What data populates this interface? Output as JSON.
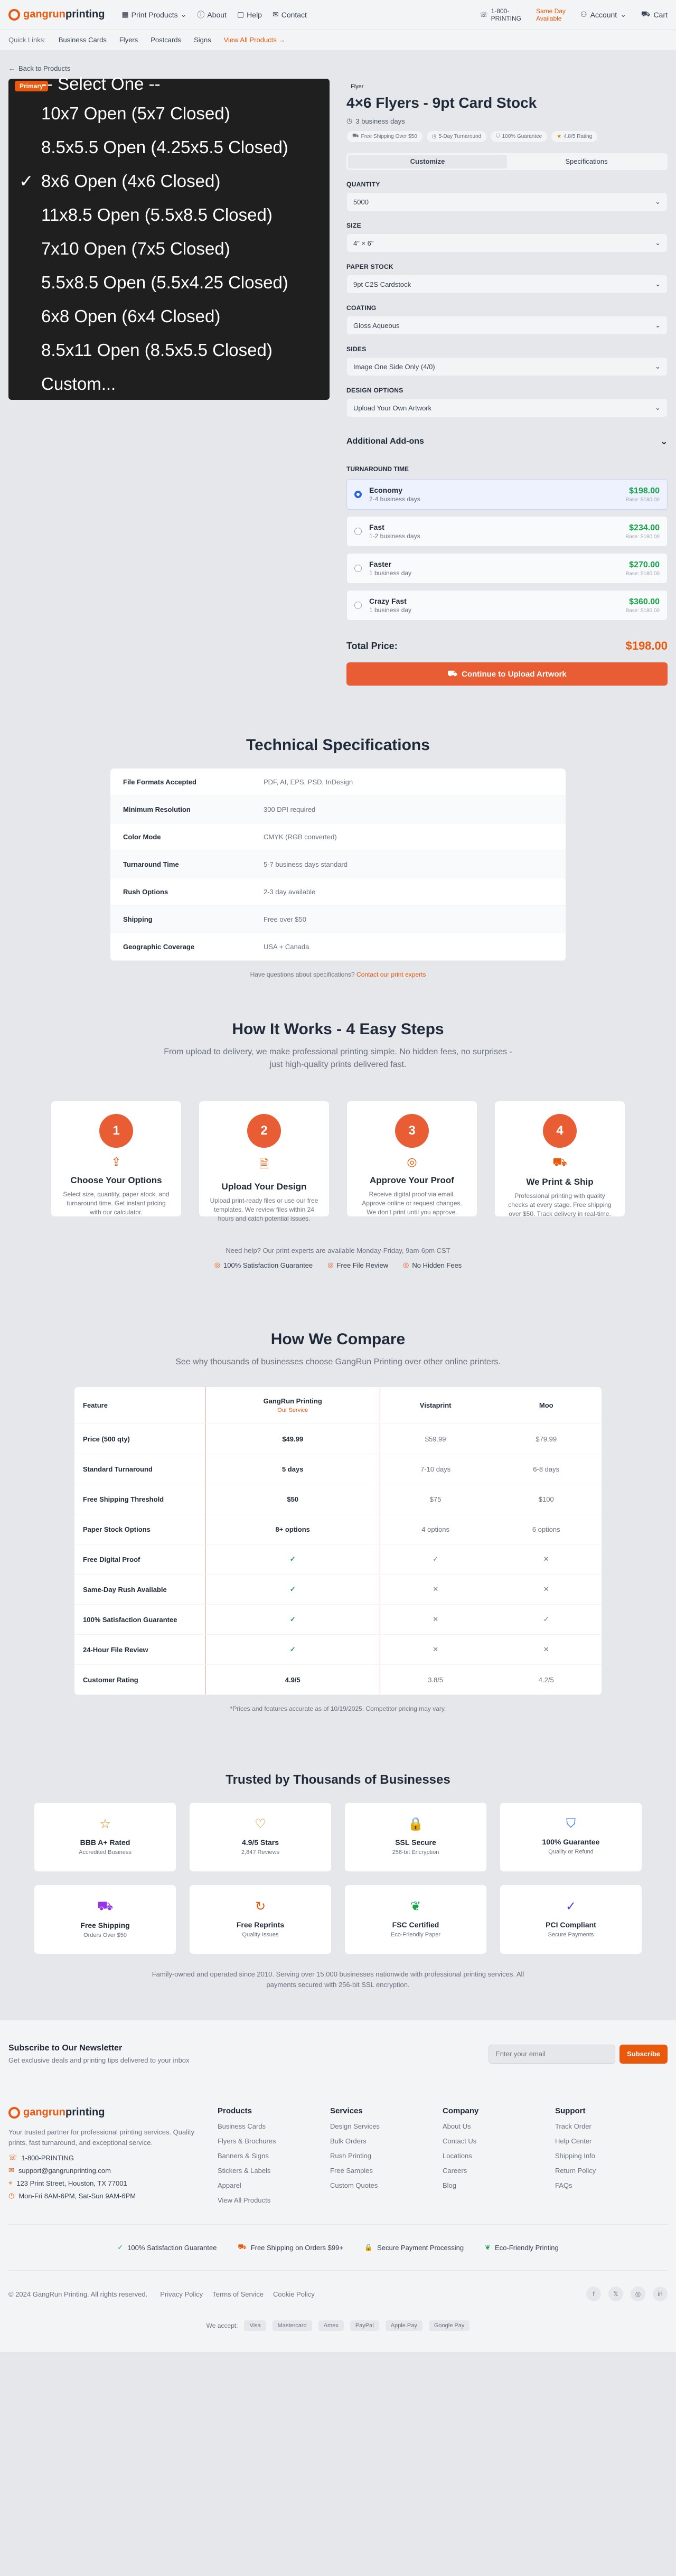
{
  "header": {
    "brand_a": "gangrun",
    "brand_b": "printing",
    "nav": [
      "Print Products",
      "About",
      "Help",
      "Contact"
    ],
    "phone": "1-800-\nPRINTING",
    "promo": "Same Day\nAvailable",
    "account": "Account",
    "cart": "Cart"
  },
  "subnav": {
    "label": "Quick Links:",
    "items": [
      "Business Cards",
      "Flyers",
      "Postcards",
      "Signs"
    ],
    "all": "View All Products"
  },
  "back": "Back to Products",
  "dropdown": {
    "badge": "Primary",
    "options": [
      "-- Select One --",
      "10x7 Open (5x7 Closed)",
      "8.5x5.5 Open (4.25x5.5 Closed)",
      "8x6 Open (4x6 Closed)",
      "11x8.5 Open (5.5x8.5 Closed)",
      "7x10 Open (7x5 Closed)",
      "5.5x8.5 Open (5.5x4.25 Closed)",
      "6x8 Open (6x4 Closed)",
      "8.5x11 Open (8.5x5.5 Closed)",
      "Custom..."
    ],
    "checkmark": "✓"
  },
  "product": {
    "tag": "Flyer",
    "title": "4×6 Flyers - 9pt Card Stock",
    "days": "3 business days",
    "chips": [
      "Free Shipping Over $50",
      "5-Day Turnaround",
      "100% Guarantee",
      "4.8/5 Rating"
    ],
    "tabs": [
      "Customize",
      "Specifications"
    ],
    "fields": [
      {
        "label": "QUANTITY",
        "value": "5000"
      },
      {
        "label": "SIZE",
        "value": "4\" × 6\""
      },
      {
        "label": "PAPER STOCK",
        "value": "9pt C2S Cardstock"
      },
      {
        "label": "COATING",
        "value": "Gloss Aqueous"
      },
      {
        "label": "SIDES",
        "value": "Image One Side Only (4/0)"
      },
      {
        "label": "DESIGN OPTIONS",
        "value": "Upload Your Own Artwork"
      }
    ],
    "addons": "Additional Add-ons",
    "turnaround_label": "TURNAROUND TIME",
    "turnaround": [
      {
        "name": "Economy",
        "desc": "2-4 business days",
        "price": "$198.00",
        "base": "Base: $180.00"
      },
      {
        "name": "Fast",
        "desc": "1-2 business days",
        "price": "$234.00",
        "base": "Base: $180.00"
      },
      {
        "name": "Faster",
        "desc": "1 business day",
        "price": "$270.00",
        "base": "Base: $180.00"
      },
      {
        "name": "Crazy Fast",
        "desc": "1 business day",
        "price": "$360.00",
        "base": "Base: $180.00"
      }
    ],
    "total_label": "Total Price:",
    "total": "$198.00",
    "cta": "Continue to Upload Artwork"
  },
  "specs": {
    "title": "Technical Specifications",
    "rows": [
      [
        "File Formats Accepted",
        "PDF, AI, EPS, PSD, InDesign"
      ],
      [
        "Minimum Resolution",
        "300 DPI required"
      ],
      [
        "Color Mode",
        "CMYK (RGB converted)"
      ],
      [
        "Turnaround Time",
        "5-7 business days standard"
      ],
      [
        "Rush Options",
        "2-3 day available"
      ],
      [
        "Shipping",
        "Free over $50"
      ],
      [
        "Geographic Coverage",
        "USA + Canada"
      ]
    ],
    "note_a": "Have questions about specifications?",
    "note_b": "Contact our print experts"
  },
  "how": {
    "title": "How It Works - 4 Easy Steps",
    "sub": "From upload to delivery, we make professional printing simple. No hidden fees, no surprises - just high-quality prints delivered fast.",
    "steps": [
      {
        "n": "1",
        "title": "Choose Your Options",
        "desc": "Select size, quantity, paper stock, and turnaround time. Get instant pricing with our calculator."
      },
      {
        "n": "2",
        "title": "Upload Your Design",
        "desc": "Upload print-ready files or use our free templates. We review files within 24 hours and catch potential issues."
      },
      {
        "n": "3",
        "title": "Approve Your Proof",
        "desc": "Receive digital proof via email. Approve online or request changes. We don't print until you approve."
      },
      {
        "n": "4",
        "title": "We Print & Ship",
        "desc": "Professional printing with quality checks at every stage. Free shipping over $50. Track delivery in real-time."
      }
    ],
    "help": "Need help? Our print experts are available Monday-Friday, 9am-6pm CST",
    "badges": [
      "100% Satisfaction Guarantee",
      "Free File Review",
      "No Hidden Fees"
    ]
  },
  "compare": {
    "title": "How We Compare",
    "sub": "See why thousands of businesses choose GangRun Printing over other online printers.",
    "headers": [
      "Feature",
      "GangRun Printing",
      "Vistaprint",
      "Moo"
    ],
    "ours": "Our Service",
    "rows": [
      [
        "Price (500 qty)",
        "$49.99",
        "$59.99",
        "$79.99"
      ],
      [
        "Standard Turnaround",
        "5 days",
        "7-10 days",
        "6-8 days"
      ],
      [
        "Free Shipping Threshold",
        "$50",
        "$75",
        "$100"
      ],
      [
        "Paper Stock Options",
        "8+ options",
        "4 options",
        "6 options"
      ],
      [
        "Free Digital Proof",
        "✓",
        "✓",
        "✕"
      ],
      [
        "Same-Day Rush Available",
        "✓",
        "✕",
        "✕"
      ],
      [
        "100% Satisfaction Guarantee",
        "✓",
        "✕",
        "✓"
      ],
      [
        "24-Hour File Review",
        "✓",
        "✕",
        "✕"
      ],
      [
        "Customer Rating",
        "4.9/5",
        "3.8/5",
        "4.2/5"
      ]
    ],
    "note": "*Prices and features accurate as of 10/19/2025. Competitor pricing may vary."
  },
  "trust": {
    "title": "Trusted by Thousands of Businesses",
    "items": [
      {
        "icon": "☆",
        "title": "BBB A+ Rated",
        "sub": "Accredited Business",
        "color": "#ca8a04"
      },
      {
        "icon": "♡",
        "title": "4.9/5 Stars",
        "sub": "2,847 Reviews",
        "color": "#ca8a04"
      },
      {
        "icon": "🔒",
        "title": "SSL Secure",
        "sub": "256-bit Encryption",
        "color": "#16a34a"
      },
      {
        "icon": "⛉",
        "title": "100% Guarantee",
        "sub": "Quality or Refund",
        "color": "#2563eb"
      },
      {
        "icon": "⛟",
        "title": "Free Shipping",
        "sub": "Orders Over $50",
        "color": "#9333ea"
      },
      {
        "icon": "↻",
        "title": "Free Reprints",
        "sub": "Quality Issues",
        "color": "#ea580c"
      },
      {
        "icon": "❦",
        "title": "FSC Certified",
        "sub": "Eco-Friendly Paper",
        "color": "#16a34a"
      },
      {
        "icon": "✓",
        "title": "PCI Compliant",
        "sub": "Secure Payments",
        "color": "#4f46e5"
      }
    ],
    "family": "Family-owned and operated since 2010. Serving over 15,000 businesses nationwide with professional printing services. All payments secured with 256-bit SSL encryption."
  },
  "newsletter": {
    "title": "Subscribe to Our Newsletter",
    "sub": "Get exclusive deals and printing tips delivered to your inbox",
    "placeholder": "Enter your email",
    "button": "Subscribe"
  },
  "footer": {
    "desc": "Your trusted partner for professional printing services. Quality prints, fast turnaround, and exceptional service.",
    "contact": [
      "1-800-PRINTING",
      "support@gangrunprinting.com",
      "123 Print Street, Houston, TX 77001",
      "Mon-Fri 8AM-6PM, Sat-Sun 9AM-6PM"
    ],
    "cols": [
      {
        "title": "Products",
        "links": [
          "Business Cards",
          "Flyers & Brochures",
          "Banners & Signs",
          "Stickers & Labels",
          "Apparel",
          "View All Products"
        ]
      },
      {
        "title": "Services",
        "links": [
          "Design Services",
          "Bulk Orders",
          "Rush Printing",
          "Free Samples",
          "Custom Quotes"
        ]
      },
      {
        "title": "Company",
        "links": [
          "About Us",
          "Contact Us",
          "Locations",
          "Careers",
          "Blog"
        ]
      },
      {
        "title": "Support",
        "links": [
          "Track Order",
          "Help Center",
          "Shipping Info",
          "Return Policy",
          "FAQs"
        ]
      }
    ],
    "badges": [
      "100% Satisfaction Guarantee",
      "Free Shipping on Orders $99+",
      "Secure Payment Processing",
      "Eco-Friendly Printing"
    ],
    "copyright": "© 2024 GangRun Printing. All rights reserved.",
    "legal": [
      "Privacy Policy",
      "Terms of Service",
      "Cookie Policy"
    ],
    "social": [
      "f",
      "𝕏",
      "◎",
      "in"
    ],
    "accept": "We accept:",
    "payments": [
      "Visa",
      "Mastercard",
      "Amex",
      "PayPal",
      "Apple Pay",
      "Google Pay"
    ]
  }
}
